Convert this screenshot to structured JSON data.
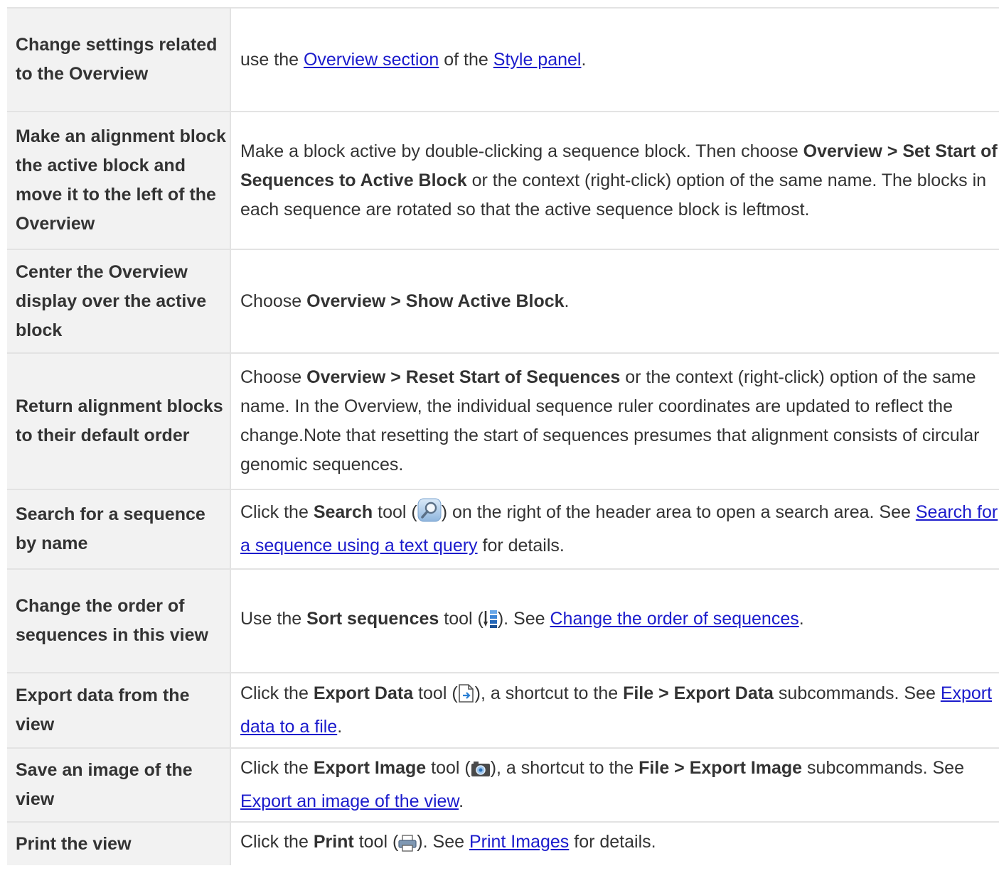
{
  "rows": [
    {
      "task": "Change settings related to the Overview",
      "d": {
        "t1": "use the ",
        "l1": "Overview section",
        "t2": " of the ",
        "l2": "Style panel",
        "t3": "."
      }
    },
    {
      "task": "Make an alignment block the active block and move it to the left of the Overview",
      "d": {
        "t1": "Make a block active by double-clicking a sequence block. Then choose ",
        "b1": "Overview > Set Start of Sequences to Active Block",
        "t2": " or the context (right-click) option of the same name. The blocks in each sequence are rotated so that the active sequence block is leftmost."
      }
    },
    {
      "task": "Center the Overview display over the active block",
      "d": {
        "t1": "Choose ",
        "b1": "Overview > Show Active Block",
        "t2": "."
      }
    },
    {
      "task": "Return alignment blocks to their default order",
      "d": {
        "t1": "Choose ",
        "b1": "Overview > Reset Start of Sequences",
        "t2": " or the context (right-click) option of the same name. In the Overview, the individual sequence ruler coordinates are updated to reflect the change.Note that resetting the start of sequences presumes that alignment consists of circular genomic sequences."
      }
    },
    {
      "task": "Search for a sequence by name",
      "d": {
        "t1": "Click the ",
        "b1": "Search",
        "t2": " tool (",
        "icon": "search-icon",
        "t3": ") on the right of the header area to open a search area. See ",
        "l1": "Search for a sequence using a text query",
        "t4": " for details."
      }
    },
    {
      "task": "Change the order of sequences in this view",
      "d": {
        "t1": "Use the ",
        "b1": "Sort sequences",
        "t2": " tool (",
        "icon": "sort-icon",
        "t3": "). See ",
        "l1": "Change the order of sequences",
        "t4": "."
      }
    },
    {
      "task": "Export data from the view",
      "d": {
        "t1": "Click the ",
        "b1": "Export Data",
        "t2": " tool (",
        "icon": "export-data-icon",
        "t3": "), a shortcut to the ",
        "b2": "File > Export Data",
        "t4": " subcommands. See ",
        "l1": "Export data to a file",
        "t5": "."
      }
    },
    {
      "task": "Save an image of the view",
      "d": {
        "t1": "Click the ",
        "b1": "Export Image",
        "t2": " tool (",
        "icon": "export-image-icon",
        "t3": "), a shortcut to the ",
        "b2": "File > Export Image",
        "t4": " subcommands. See ",
        "l1": "Export an image of the view",
        "t5": "."
      }
    },
    {
      "task": "Print the view",
      "d": {
        "t1": "Click the ",
        "b1": "Print",
        "t2": " tool (",
        "icon": "print-icon",
        "t3": "). See ",
        "l1": "Print Images",
        "t4": " for details."
      }
    }
  ]
}
